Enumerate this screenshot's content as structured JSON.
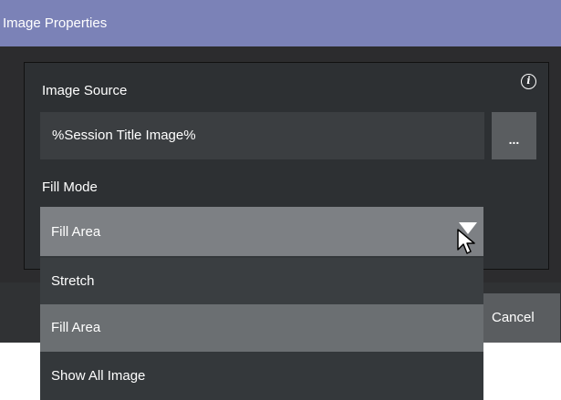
{
  "window": {
    "title": "Image Properties"
  },
  "image_source": {
    "label": "Image Source",
    "value": "%Session Title Image%",
    "browse_label": "..."
  },
  "fill_mode": {
    "label": "Fill Mode",
    "selected": "Fill Area",
    "options": [
      "Stretch",
      "Fill Area",
      "Show All Image"
    ]
  },
  "footer": {
    "cancel_label": "Cancel"
  },
  "icons": {
    "info": "info-icon",
    "dropdown_arrow": "chevron-down-icon",
    "cursor": "mouse-pointer-icon"
  },
  "colors": {
    "titlebar": "#7b82b7",
    "dialog_bg": "#2c2c2e",
    "input_bg": "#3b3e41",
    "select_bg": "#7d8084",
    "option_highlight": "#6b6f72"
  }
}
